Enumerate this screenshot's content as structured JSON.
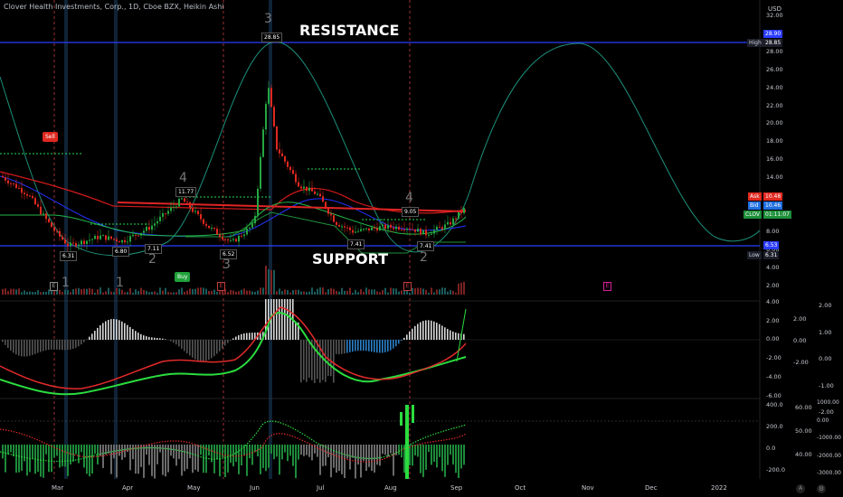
{
  "header": {
    "symbol_title": "Clover Health Investments, Corp., 1D, Cboe BZX, Heikin Ashi",
    "currency": "USD"
  },
  "annotations": {
    "resistance": "RESISTANCE",
    "support": "SUPPORT",
    "sell": "Sell",
    "buy": "Buy"
  },
  "price_labels": {
    "p1": "6.31",
    "p2": "6.80",
    "p3": "7.11",
    "p4": "11.77",
    "p5": "6.52",
    "p6": "28.85",
    "p7": "7.41",
    "p8": "9.05",
    "p9": "7.41"
  },
  "wave_counts": [
    "3",
    "4",
    "2",
    "3",
    "4",
    "2",
    "1",
    "1"
  ],
  "right_axis": {
    "main_ticks": [
      "32.00",
      "30.00",
      "28.00",
      "26.00",
      "24.00",
      "22.00",
      "20.00",
      "18.00",
      "16.00",
      "14.00",
      "12.00",
      "10.00",
      "8.00",
      "6.00",
      "4.00",
      "2.00"
    ],
    "osc1_ticks": [
      "4.00",
      "2.00",
      "0.00",
      "-2.00",
      "-4.00",
      "-6.00"
    ],
    "osc1_right_ticks": [
      "2.00",
      "1.00",
      "0.00",
      "-1.00",
      "-2.00"
    ],
    "osc1_mid_ticks": [
      "2.00",
      "0.00",
      "-2.00"
    ],
    "osc2_ticks": [
      "400.0",
      "200.0",
      "0.0",
      "-200.0"
    ],
    "osc2_mid_ticks": [
      "60.00",
      "50.00",
      "40.00"
    ],
    "osc2_right_ticks": [
      "1000.00",
      "0.00",
      "-1000.00",
      "-2000.00",
      "-3000.00"
    ]
  },
  "right_tags": {
    "resistance_val": "28.90",
    "high_label": "High",
    "high_val": "28.85",
    "ask_label": "Ask",
    "ask_val": "10.48",
    "bid_label": "Bid",
    "bid_val": "10.46",
    "symbol": "CLOV",
    "countdown": "01:11:07",
    "support_val": "6.53",
    "low_label": "Low",
    "low_val": "6.31"
  },
  "time_axis": [
    "Mar",
    "Apr",
    "May",
    "Jun",
    "Jul",
    "Aug",
    "Sep",
    "Oct",
    "Nov",
    "Dec",
    "2022"
  ],
  "earnings_marker": "E",
  "footer_icons": [
    "A",
    "settings-icon"
  ],
  "colors": {
    "resistance_line": "#2a3cff",
    "support_line": "#2a3cff",
    "sine_wave": "#1c8f7a",
    "up_candle": "#26a641",
    "down_candle": "#e0291f",
    "sell_flag": "#e0291f",
    "buy_flag": "#21a23b",
    "event_marker": "#d6219b"
  }
}
